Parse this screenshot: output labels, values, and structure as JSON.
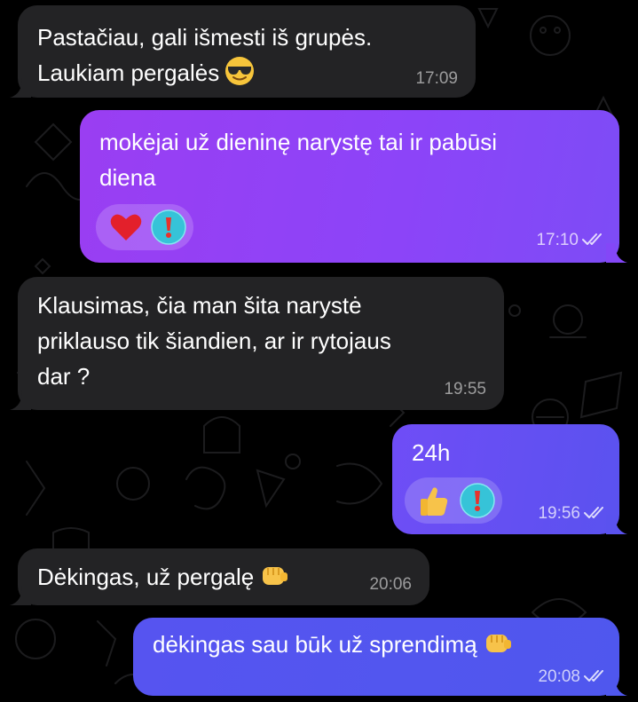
{
  "chat": {
    "messages": [
      {
        "direction": "incoming",
        "lines": [
          "Pastačiau, gali išmesti iš grupės.",
          "Laukiam pergalės"
        ],
        "trailing_emoji": "smiling-face-with-sunglasses",
        "time": "17:09"
      },
      {
        "direction": "outgoing",
        "lines": [
          "mokėjai už dieninę narystę tai ir pabūsi",
          "diena"
        ],
        "reactions": [
          "red-heart",
          "exclamation-mark"
        ],
        "time": "17:10",
        "status": "read"
      },
      {
        "direction": "incoming",
        "lines": [
          "Klausimas, čia man šita narystė",
          "priklauso tik šiandien, ar ir rytojaus",
          "dar ?"
        ],
        "time": "19:55"
      },
      {
        "direction": "outgoing",
        "lines": [
          "24h"
        ],
        "reactions": [
          "thumbs-up",
          "exclamation-mark"
        ],
        "time": "19:56",
        "status": "read"
      },
      {
        "direction": "incoming",
        "lines": [
          "Dėkingas, už pergalę"
        ],
        "trailing_emoji": "oncoming-fist",
        "time": "20:06"
      },
      {
        "direction": "outgoing",
        "lines": [
          "dėkingas sau būk už sprendimą"
        ],
        "trailing_emoji": "oncoming-fist",
        "time": "20:08",
        "status": "read"
      }
    ]
  },
  "colors": {
    "background": "#000000",
    "incoming_bubble": "#232325",
    "outgoing_purple": "#8c44f8",
    "outgoing_blue": "#5654f0",
    "time_text": "#8e8e93"
  }
}
